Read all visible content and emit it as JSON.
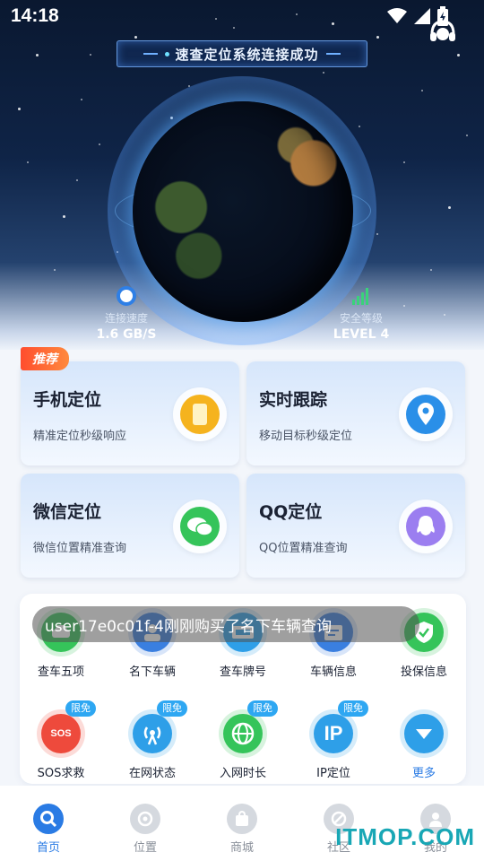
{
  "status_bar": {
    "time": "14:18"
  },
  "hero": {
    "banner_text": "速查定位系统连接成功",
    "speed": {
      "label": "连接速度",
      "value": "1.6 GB/S"
    },
    "security": {
      "label": "安全等级",
      "value": "LEVEL 4"
    }
  },
  "recommend_tag": "推荐",
  "cards": [
    {
      "title": "手机定位",
      "subtitle": "精准定位秒级响应",
      "icon": "phone-icon",
      "color": "#f5b31e"
    },
    {
      "title": "实时跟踪",
      "subtitle": "移动目标秒级定位",
      "icon": "location-pin-icon",
      "color": "#2a8fe8"
    },
    {
      "title": "微信定位",
      "subtitle": "微信位置精准查询",
      "icon": "wechat-icon",
      "color": "#35c45a"
    },
    {
      "title": "QQ定位",
      "subtitle": "QQ位置精准查询",
      "icon": "qq-icon",
      "color": "#9b7ef0"
    }
  ],
  "toast": "user17e0c01f-4刚刚购买了名下车辆查询",
  "grid": [
    {
      "label": "查车五项",
      "icon": "car-check-icon",
      "color": "#35c45a"
    },
    {
      "label": "名下车辆",
      "icon": "owner-vehicle-icon",
      "color": "#3a7fe0"
    },
    {
      "label": "查车牌号",
      "icon": "plate-icon",
      "color": "#2e9fe8"
    },
    {
      "label": "车辆信息",
      "icon": "vehicle-info-icon",
      "color": "#3a7fe0"
    },
    {
      "label": "投保信息",
      "icon": "insurance-icon",
      "color": "#35c45a"
    },
    {
      "label": "SOS求救",
      "icon": "sos-icon",
      "color": "#ee4a3c",
      "badge": "限免",
      "glyph": "SOS"
    },
    {
      "label": "在网状态",
      "icon": "signal-tower-icon",
      "color": "#2e9fe8",
      "badge": "限免"
    },
    {
      "label": "入网时长",
      "icon": "globe-icon",
      "color": "#35c45a",
      "badge": "限免"
    },
    {
      "label": "IP定位",
      "icon": "ip-icon",
      "color": "#2e9fe8",
      "badge": "限免",
      "glyph": "IP"
    },
    {
      "label": "更多",
      "icon": "chevron-down-icon",
      "color": "#2e9fe8"
    }
  ],
  "tabs": [
    {
      "label": "首页",
      "icon": "search-icon",
      "active": true
    },
    {
      "label": "位置",
      "icon": "target-icon"
    },
    {
      "label": "商城",
      "icon": "shopping-bag-icon"
    },
    {
      "label": "社区",
      "icon": "community-icon"
    },
    {
      "label": "我的",
      "icon": "user-icon"
    }
  ],
  "watermark": "ITMOP.COM"
}
